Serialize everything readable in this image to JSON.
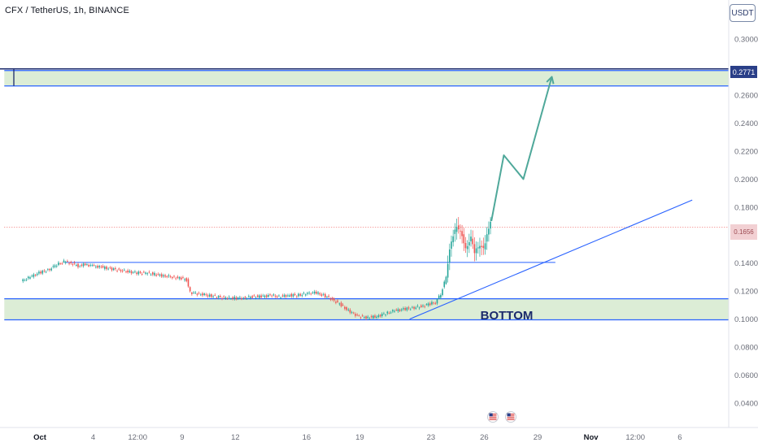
{
  "header": {
    "title": "CFX / TetherUS, 1h, BINANCE",
    "currency_button": "USDT"
  },
  "colors": {
    "candle_up": "#26a69a",
    "candle_down": "#ef5350",
    "zone_fill": "#d8ebd2",
    "zone_border": "#2962ff",
    "projection": "#4fa89a",
    "trendline": "#2962ff",
    "price_tag": "#2a3f88"
  },
  "chart_data": {
    "type": "candlestick",
    "title": "CFX / TetherUS, 1h, BINANCE",
    "y_axis": {
      "min": 0.028,
      "max": 0.312,
      "ticks": [
        0.3,
        0.26,
        0.24,
        0.22,
        0.2,
        0.18,
        0.14,
        0.12,
        0.1,
        0.08,
        0.06,
        0.04
      ],
      "tick_labels": [
        "0.3000",
        "0.2600",
        "0.2400",
        "0.2200",
        "0.2000",
        "0.1800",
        "0.1400",
        "0.1200",
        "0.1000",
        "0.0800",
        "0.0600",
        "0.0400"
      ]
    },
    "x_axis": {
      "ticks": [
        {
          "label": "Oct",
          "day": 1
        },
        {
          "label": "4",
          "day": 4
        },
        {
          "label": "12:00",
          "day": 6.5
        },
        {
          "label": "9",
          "day": 9
        },
        {
          "label": "12",
          "day": 12
        },
        {
          "label": "16",
          "day": 16
        },
        {
          "label": "19",
          "day": 19
        },
        {
          "label": "23",
          "day": 23
        },
        {
          "label": "26",
          "day": 26
        },
        {
          "label": "29",
          "day": 29
        },
        {
          "label": "Nov",
          "day": 32
        },
        {
          "label": "12:00",
          "day": 34.5
        },
        {
          "label": "6",
          "day": 37
        }
      ]
    },
    "price_series": [
      [
        0.0,
        0.127
      ],
      [
        0.5,
        0.13
      ],
      [
        1.0,
        0.133
      ],
      [
        1.5,
        0.135
      ],
      [
        1.8,
        0.137
      ],
      [
        2.0,
        0.139
      ],
      [
        2.4,
        0.141
      ],
      [
        2.8,
        0.14
      ],
      [
        3.2,
        0.138
      ],
      [
        3.6,
        0.139
      ],
      [
        4.0,
        0.138
      ],
      [
        4.5,
        0.137
      ],
      [
        5.0,
        0.136
      ],
      [
        5.5,
        0.135
      ],
      [
        6.0,
        0.134
      ],
      [
        6.5,
        0.133
      ],
      [
        7.0,
        0.133
      ],
      [
        7.5,
        0.132
      ],
      [
        8.0,
        0.131
      ],
      [
        8.5,
        0.13
      ],
      [
        9.0,
        0.129
      ],
      [
        9.3,
        0.128
      ],
      [
        9.5,
        0.119
      ],
      [
        10.0,
        0.118
      ],
      [
        10.5,
        0.117
      ],
      [
        11.0,
        0.116
      ],
      [
        11.5,
        0.115
      ],
      [
        12.0,
        0.115
      ],
      [
        12.5,
        0.115
      ],
      [
        13.0,
        0.116
      ],
      [
        13.5,
        0.116
      ],
      [
        14.0,
        0.117
      ],
      [
        14.5,
        0.116
      ],
      [
        15.0,
        0.117
      ],
      [
        15.5,
        0.117
      ],
      [
        16.0,
        0.118
      ],
      [
        16.5,
        0.119
      ],
      [
        17.0,
        0.117
      ],
      [
        17.5,
        0.114
      ],
      [
        18.0,
        0.11
      ],
      [
        18.5,
        0.105
      ],
      [
        19.0,
        0.102
      ],
      [
        19.5,
        0.101
      ],
      [
        20.0,
        0.102
      ],
      [
        20.5,
        0.104
      ],
      [
        21.0,
        0.106
      ],
      [
        21.5,
        0.107
      ],
      [
        22.0,
        0.108
      ],
      [
        22.5,
        0.109
      ],
      [
        23.0,
        0.111
      ],
      [
        23.3,
        0.112
      ],
      [
        23.6,
        0.118
      ],
      [
        23.9,
        0.13
      ],
      [
        24.1,
        0.15
      ],
      [
        24.3,
        0.16
      ],
      [
        24.5,
        0.166
      ],
      [
        24.8,
        0.16
      ],
      [
        25.0,
        0.15
      ],
      [
        25.3,
        0.158
      ],
      [
        25.5,
        0.148
      ],
      [
        25.8,
        0.153
      ],
      [
        26.0,
        0.15
      ],
      [
        26.2,
        0.16
      ],
      [
        26.4,
        0.17
      ]
    ],
    "zones": [
      {
        "name": "target-zone",
        "from_day": -1,
        "to_day": 40,
        "y_low": 0.2665,
        "y_high": 0.2775
      },
      {
        "name": "bottom-zone",
        "label": "BOTTOM",
        "from_day": -1,
        "to_day": 40,
        "y_low": 0.0995,
        "y_high": 0.1145
      }
    ],
    "levels": [
      {
        "name": "resistance-line",
        "from_day": 2.4,
        "to_day": 30.0,
        "y": 0.1405
      },
      {
        "name": "current-price-line",
        "from_day": -1,
        "to_day": 40,
        "y": 0.1656
      }
    ],
    "trendline": {
      "from": [
        21.8,
        0.1
      ],
      "to": [
        37.7,
        0.185
      ]
    },
    "projection": [
      [
        26.4,
        0.17
      ],
      [
        27.1,
        0.217
      ],
      [
        28.2,
        0.2
      ],
      [
        29.8,
        0.273
      ]
    ],
    "axis_price_tag": "0.2771",
    "current_price_label": "0.1656"
  }
}
